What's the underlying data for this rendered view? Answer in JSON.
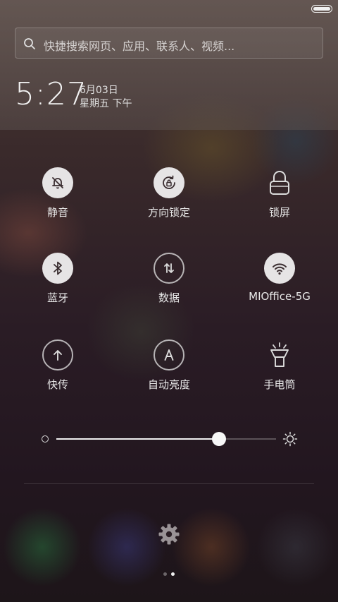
{
  "status_bar": {
    "battery_level": 1.0
  },
  "search": {
    "placeholder": "快捷搜索网页、应用、联系人、视频..."
  },
  "clock": {
    "time": "5:27",
    "date": "6月03日",
    "weekday": "星期五 下午"
  },
  "toggles": [
    {
      "label": "静音",
      "icon": "bell-off-icon",
      "active": true
    },
    {
      "label": "方向锁定",
      "icon": "rotation-lock-icon",
      "active": true
    },
    {
      "label": "锁屏",
      "icon": "lock-icon",
      "active": false
    },
    {
      "label": "蓝牙",
      "icon": "bluetooth-icon",
      "active": true
    },
    {
      "label": "数据",
      "icon": "mobile-data-icon",
      "active": false
    },
    {
      "label": "MIOffice-5G",
      "icon": "wifi-icon",
      "active": true
    },
    {
      "label": "快传",
      "icon": "quick-transfer-icon",
      "active": false
    },
    {
      "label": "自动亮度",
      "icon": "auto-brightness-icon",
      "active": false
    },
    {
      "label": "手电筒",
      "icon": "flashlight-icon",
      "active": false
    }
  ],
  "brightness": {
    "level": 0.74
  },
  "pager": {
    "pages": 2,
    "current": 2
  },
  "colors": {
    "active_toggle_bg": "#e6e4e5",
    "active_icon": "#3a2d30",
    "inactive_icon": "#dcdcdc"
  }
}
